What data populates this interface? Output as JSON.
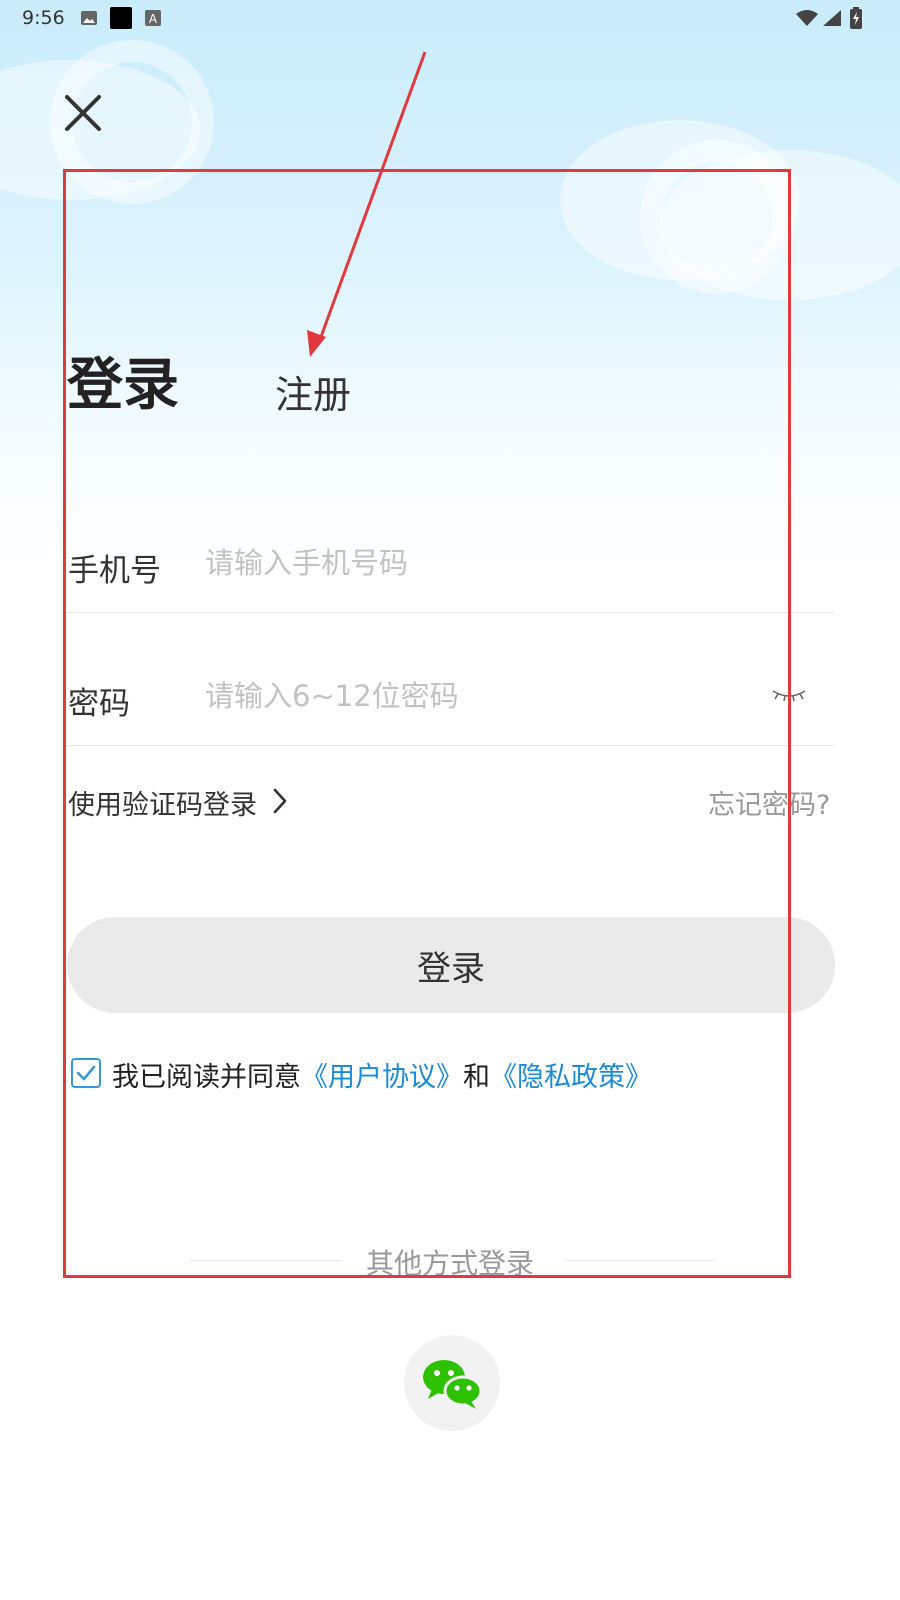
{
  "status_bar": {
    "time": "9:56"
  },
  "tabs": {
    "login": "登录",
    "register": "注册"
  },
  "phone": {
    "label": "手机号",
    "placeholder": "请输入手机号码"
  },
  "password": {
    "label": "密码",
    "placeholder": "请输入6~12位密码"
  },
  "links": {
    "sms_login": "使用验证码登录",
    "forgot": "忘记密码?"
  },
  "login_button": "登录",
  "agreement": {
    "prefix": "我已阅读并同意",
    "user_agreement": "《用户协议》",
    "and": "和",
    "privacy": "《隐私政策》",
    "checked": true
  },
  "other_login": {
    "title": "其他方式登录"
  },
  "icons": [
    "close-icon",
    "eye-closed-icon",
    "chevron-right-icon",
    "checkbox-checked-icon",
    "wechat-icon",
    "wifi-icon",
    "signal-icon",
    "battery-icon"
  ],
  "colors": {
    "accent": "#1e8ad6",
    "annotation": "#e0393e",
    "wechat": "#2ec100"
  }
}
